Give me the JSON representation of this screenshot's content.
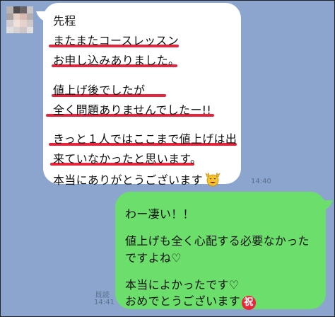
{
  "incoming": {
    "lines": [
      "先程",
      "またまたコースレッスン",
      "お申し込みありました。",
      "値上げ後でしたが",
      "全く問題ありませんでしたー!!",
      "きっと１人ではここまで値上げは出",
      "来ていなかったと思います。",
      "本当にありがとうございます"
    ],
    "emoji": "face-with-raised-hands-emoji",
    "time": "14:40",
    "highlight_color": "#e8233c"
  },
  "outgoing": {
    "lines": [
      "わー凄い！！",
      "値上げも全く心配する必要なかった",
      "ですよね♡",
      "本当によかったです♡",
      "おめでとうございます"
    ],
    "stamp": "祝",
    "read_label": "既読",
    "time": "14:41"
  },
  "colors": {
    "background": "#8ba5cf",
    "incoming_bubble": "#ffffff",
    "outgoing_bubble": "#6cde6b"
  }
}
